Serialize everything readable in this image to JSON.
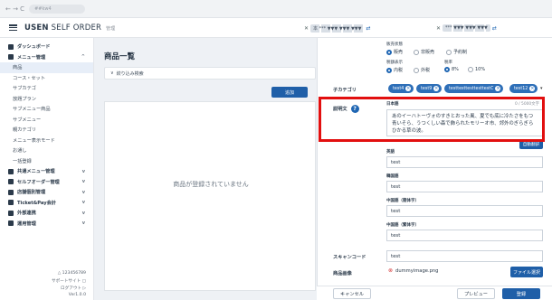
{
  "browser": {
    "nav": "← → C",
    "url": "##kw4"
  },
  "header": {
    "brand_bold": "USEN",
    "brand_light": "SELF ORDER",
    "brand_suffix": "管理",
    "selector1": "本 *** ▼▼▼ ▼▼▼ ▼▼▼",
    "selector2": "*** ▼▼▼ ▼▼▼ ▼▼▼"
  },
  "sidebar": {
    "items": [
      {
        "label": "ダッシュボード",
        "kind": "head",
        "icon": "dashboard-icon"
      },
      {
        "label": "メニュー管理",
        "kind": "head",
        "icon": "menu-icon",
        "chevron": "^"
      },
      {
        "label": "商品",
        "kind": "sub",
        "active": true
      },
      {
        "label": "コース・セット",
        "kind": "sub"
      },
      {
        "label": "サブカテゴ",
        "kind": "sub"
      },
      {
        "label": "放題プラン",
        "kind": "sub"
      },
      {
        "label": "サブメニュー商品",
        "kind": "sub"
      },
      {
        "label": "サブメニュー",
        "kind": "sub"
      },
      {
        "label": "親カテゴリ",
        "kind": "sub"
      },
      {
        "label": "メニュー表示モード",
        "kind": "sub"
      },
      {
        "label": "お通し",
        "kind": "sub"
      },
      {
        "label": "一括登録",
        "kind": "sub"
      },
      {
        "label": "共通メニュー管理",
        "kind": "head",
        "icon": "common-menu-icon",
        "chevron": "v"
      },
      {
        "label": "セルフオーダー管理",
        "kind": "head",
        "icon": "self-order-icon",
        "chevron": "v"
      },
      {
        "label": "店舗個別管理",
        "kind": "head",
        "icon": "store-icon",
        "chevron": "v"
      },
      {
        "label": "Ticket&Pay会計",
        "kind": "head",
        "icon": "ticket-icon",
        "chevron": "v"
      },
      {
        "label": "外部連携",
        "kind": "head",
        "icon": "link-icon",
        "chevron": "v"
      },
      {
        "label": "運用管理",
        "kind": "head",
        "icon": "ops-icon",
        "chevron": "v"
      }
    ],
    "footer": {
      "user": "△ 123456789",
      "support": "サポートサイト ▢",
      "logout": "ログアウト ▷",
      "version": "Ver1.0.0"
    }
  },
  "main": {
    "title": "商品一覧",
    "filter_label": "絞り込み検索",
    "add_label": "追加",
    "empty_text": "商品が登録されていません"
  },
  "panel": {
    "status_label": "販売状態",
    "status_options": [
      "販売",
      "非販売",
      "予約制"
    ],
    "tax_label": "税額表示",
    "tax_options": [
      "内税",
      "外税"
    ],
    "rate_label": "税率",
    "rate_options": [
      "8%",
      "10%"
    ],
    "subcategory_label": "子カテゴリ",
    "chips": [
      "test4",
      "test9",
      "testtesttesttesttestC",
      "test12"
    ],
    "desc_label": "説明文",
    "jp_label": "日本語",
    "counter": "0 / 5000文字",
    "desc_text": "あのイーハトーヴォのすきとおった風、夏でも底に冷たさをもつ青いそら、うつくしい森で飾られたモリーオ市、郊外のぎらぎらひかる草の波。",
    "auto_translate": "自動翻訳",
    "en_label": "英語",
    "en_value": "test",
    "ko_label": "韓国語",
    "ko_value": "test",
    "zh_s_label": "中国語（簡体字）",
    "zh_s_value": "test",
    "zh_t_label": "中国語（繁体字）",
    "zh_t_value": "test",
    "scan_label": "スキャンコード",
    "scan_value": "test",
    "image_label": "商品画像",
    "image_file": "dummyimage.png",
    "file_button": "ファイル選択",
    "cancel": "キャンセル",
    "preview": "プレビュー",
    "register": "登録"
  }
}
